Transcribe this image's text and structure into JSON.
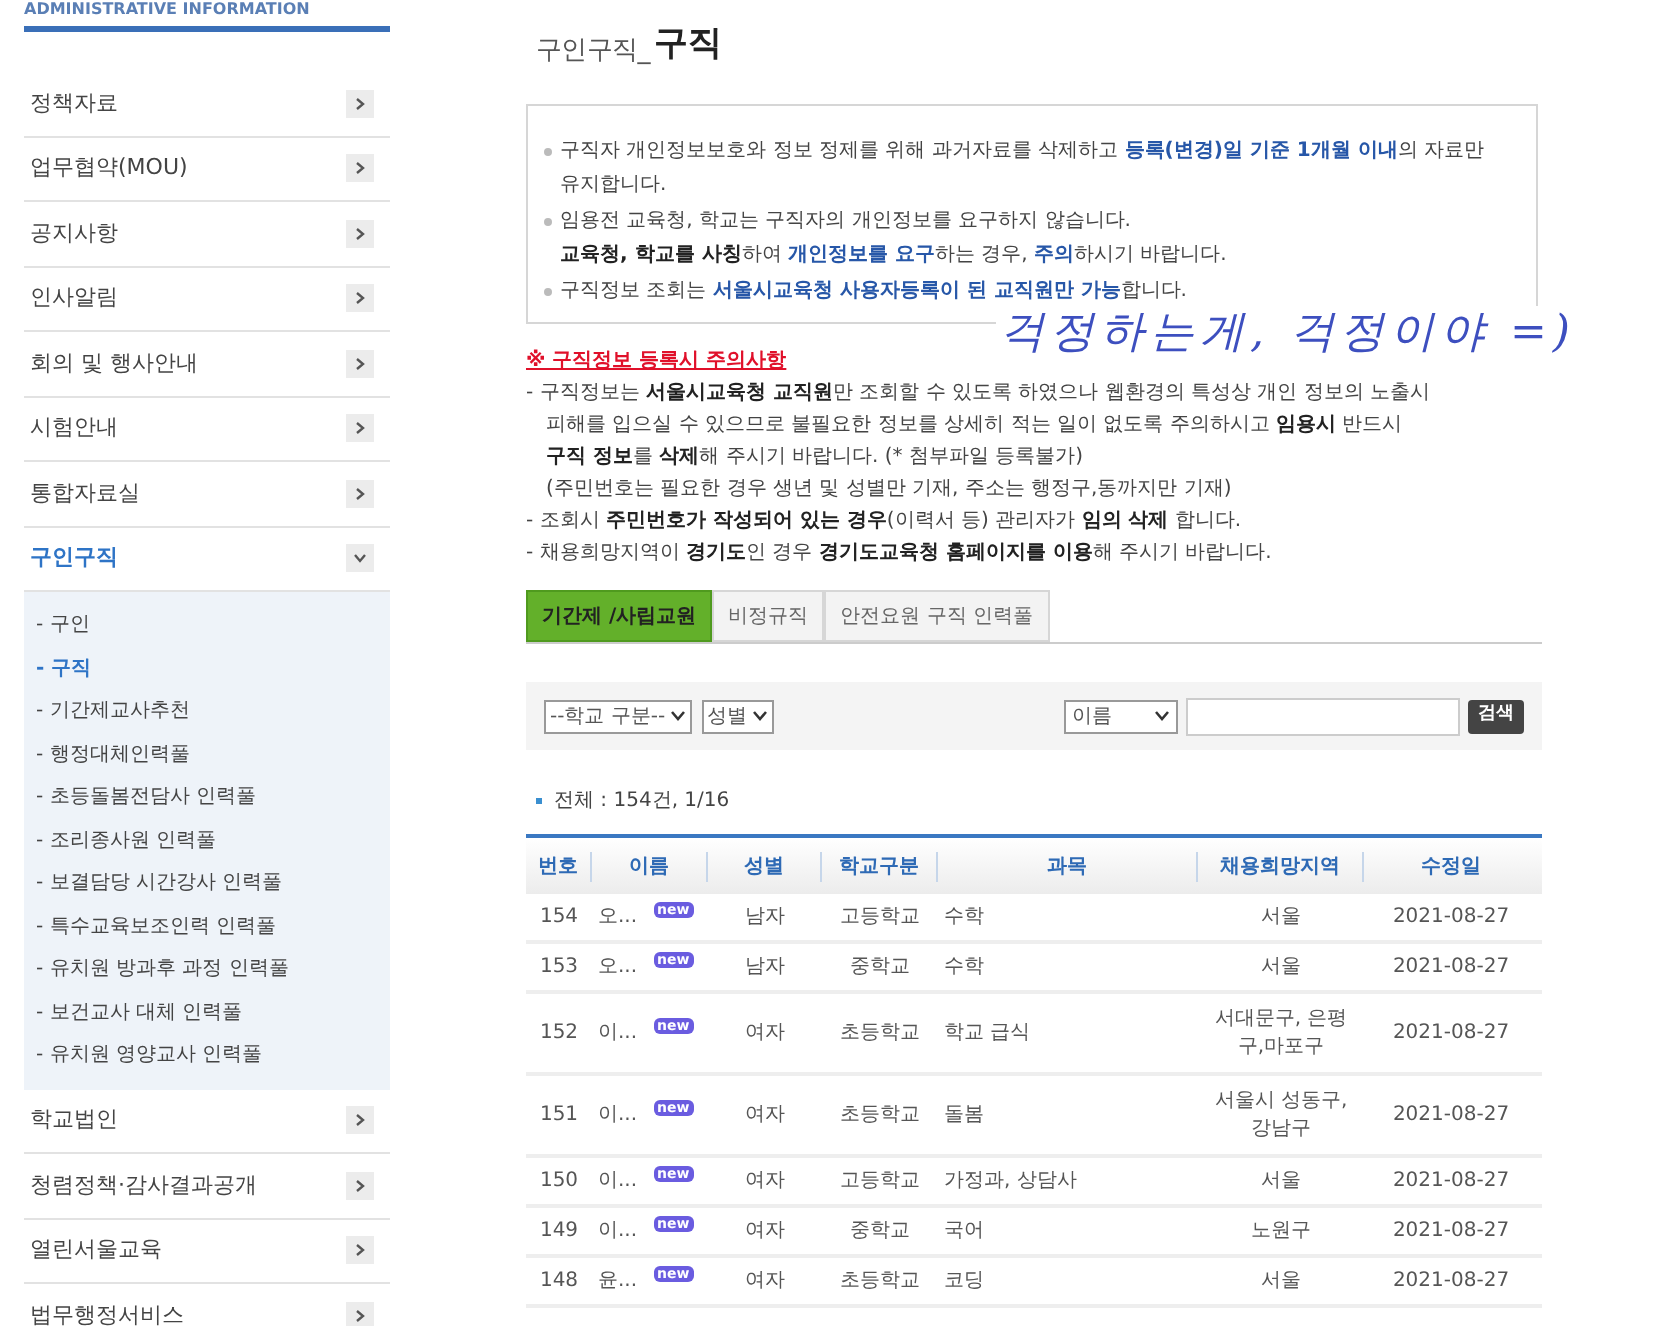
{
  "sidebar": {
    "heading": "ADMINISTRATIVE INFORMATION",
    "items": [
      {
        "label": "정책자료",
        "expanded": false
      },
      {
        "label": "업무협약(MOU)",
        "expanded": false
      },
      {
        "label": "공지사항",
        "expanded": false
      },
      {
        "label": "인사알림",
        "expanded": false
      },
      {
        "label": "회의 및 행사안내",
        "expanded": false
      },
      {
        "label": "시험안내",
        "expanded": false
      },
      {
        "label": "통합자료실",
        "expanded": false
      },
      {
        "label": "구인구직",
        "expanded": true,
        "children": [
          {
            "label": "- 구인",
            "selected": false
          },
          {
            "label": "- 구직",
            "selected": true
          },
          {
            "label": "- 기간제교사추천",
            "selected": false
          },
          {
            "label": "- 행정대체인력풀",
            "selected": false
          },
          {
            "label": "- 초등돌봄전담사 인력풀",
            "selected": false
          },
          {
            "label": "- 조리종사원 인력풀",
            "selected": false
          },
          {
            "label": "- 보결담당 시간강사 인력풀",
            "selected": false
          },
          {
            "label": "- 특수교육보조인력 인력풀",
            "selected": false
          },
          {
            "label": "- 유치원 방과후 과정 인력풀",
            "selected": false
          },
          {
            "label": "- 보건교사 대체 인력풀",
            "selected": false
          },
          {
            "label": "- 유치원 영양교사 인력풀",
            "selected": false
          }
        ]
      },
      {
        "label": "학교법인",
        "expanded": false
      },
      {
        "label": "청렴정책·감사결과공개",
        "expanded": false
      },
      {
        "label": "열린서울교육",
        "expanded": false
      },
      {
        "label": "법무행정서비스",
        "expanded": false
      }
    ]
  },
  "page_title": {
    "section": "구인구직_",
    "title": "구직"
  },
  "notice": [
    {
      "lines": [
        [
          {
            "text": "구직자 개인정보보호와 정보 정제를 위해 과거자료를 삭제하고 ",
            "kind": "plain"
          },
          {
            "text": "등록(변경)일 기준 1개월 이내",
            "kind": "blue"
          },
          {
            "text": "의 자료만 유지합니다.",
            "kind": "plain"
          }
        ]
      ]
    },
    {
      "lines": [
        [
          {
            "text": "임용전 교육청, 학교는 구직자의 개인정보를 요구하지 않습니다.",
            "kind": "plain"
          }
        ],
        [
          {
            "text": "교육청, 학교를 사칭",
            "kind": "dark"
          },
          {
            "text": "하여 ",
            "kind": "plain"
          },
          {
            "text": "개인정보를 요구",
            "kind": "blue"
          },
          {
            "text": "하는 경우, ",
            "kind": "plain"
          },
          {
            "text": "주의",
            "kind": "blue"
          },
          {
            "text": "하시기 바랍니다.",
            "kind": "plain"
          }
        ]
      ]
    },
    {
      "lines": [
        [
          {
            "text": "구직정보 조회는 ",
            "kind": "plain"
          },
          {
            "text": "서울시교육청 사용자등록이 된 교직원만 가능",
            "kind": "blue"
          },
          {
            "text": "합니다.",
            "kind": "plain"
          }
        ]
      ]
    }
  ],
  "annotation": "걱정하는게, 걱정이야 =)",
  "caution": {
    "title": "※ 구직정보 등록시 주의사항",
    "items": [
      {
        "lines": [
          [
            {
              "text": "- 구직정보는 ",
              "kind": "plain"
            },
            {
              "text": "서울시교육청 교직원",
              "kind": "dark"
            },
            {
              "text": "만 조회할 수 있도록 하였으나 웹환경의 특성상 개인 정보의 노출시",
              "kind": "plain"
            }
          ],
          [
            {
              "text": "피해를 입으실 수 있으므로 불필요한 정보를 상세히 적는 일이 없도록 주의하시고 ",
              "kind": "plain"
            },
            {
              "text": "임용시",
              "kind": "dark"
            },
            {
              "text": " 반드시",
              "kind": "plain"
            }
          ],
          [
            {
              "text": "구직 정보",
              "kind": "dark"
            },
            {
              "text": "를 ",
              "kind": "plain"
            },
            {
              "text": "삭제",
              "kind": "dark"
            },
            {
              "text": "해 주시기 바랍니다. (* 첨부파일 등록불가)",
              "kind": "plain"
            }
          ],
          [
            {
              "text": "(주민번호는 필요한 경우 생년 및 성별만 기재, 주소는 행정구,동까지만 기재)",
              "kind": "plain"
            }
          ]
        ]
      },
      {
        "lines": [
          [
            {
              "text": "- 조회시 ",
              "kind": "plain"
            },
            {
              "text": "주민번호가 작성되어 있는 경우",
              "kind": "dark"
            },
            {
              "text": "(이력서 등) 관리자가 ",
              "kind": "plain"
            },
            {
              "text": "임의 삭제",
              "kind": "dark"
            },
            {
              "text": " 합니다.",
              "kind": "plain"
            }
          ]
        ]
      },
      {
        "lines": [
          [
            {
              "text": "- 채용희망지역이 ",
              "kind": "plain"
            },
            {
              "text": "경기도",
              "kind": "dark"
            },
            {
              "text": "인 경우 ",
              "kind": "plain"
            },
            {
              "text": "경기도교육청 홈페이지를 이용",
              "kind": "dark"
            },
            {
              "text": "해 주시기 바랍니다.",
              "kind": "plain"
            }
          ]
        ]
      }
    ]
  },
  "tabs": [
    {
      "label": "기간제 /사립교원",
      "selected": true
    },
    {
      "label": "비정규직",
      "selected": false
    },
    {
      "label": "안전요원 구직 인력풀",
      "selected": false
    }
  ],
  "filters": {
    "school_type": "--학교 구분--",
    "gender": "성별",
    "search_by": "이름",
    "search_button": "검색"
  },
  "summary": "전체 : 154건, 1/16",
  "table": {
    "columns": [
      "번호",
      "이름",
      "성별",
      "학교구분",
      "과목",
      "채용희망지역",
      "수정일"
    ],
    "rows": [
      {
        "cells": [
          "154",
          "오...",
          "남자",
          "고등학교",
          "수학",
          "서울",
          "2021-08-27"
        ],
        "badge": "new"
      },
      {
        "cells": [
          "153",
          "오...",
          "남자",
          "중학교",
          "수학",
          "서울",
          "2021-08-27"
        ],
        "badge": "new"
      },
      {
        "cells": [
          "152",
          "이...",
          "여자",
          "초등학교",
          "학교 급식",
          "서대문구, 은평구,마포구",
          "2021-08-27"
        ],
        "badge": "new"
      },
      {
        "cells": [
          "151",
          "이...",
          "여자",
          "초등학교",
          "돌봄",
          "서울시 성동구, 강남구",
          "2021-08-27"
        ],
        "badge": "new"
      },
      {
        "cells": [
          "150",
          "이...",
          "여자",
          "고등학교",
          "가정과, 상담사",
          "서울",
          "2021-08-27"
        ],
        "badge": "new"
      },
      {
        "cells": [
          "149",
          "이...",
          "여자",
          "중학교",
          "국어",
          "노원구",
          "2021-08-27"
        ],
        "badge": "new"
      },
      {
        "cells": [
          "148",
          "윤...",
          "여자",
          "초등학교",
          "코딩",
          "서울",
          "2021-08-27"
        ],
        "badge": "new"
      }
    ]
  }
}
